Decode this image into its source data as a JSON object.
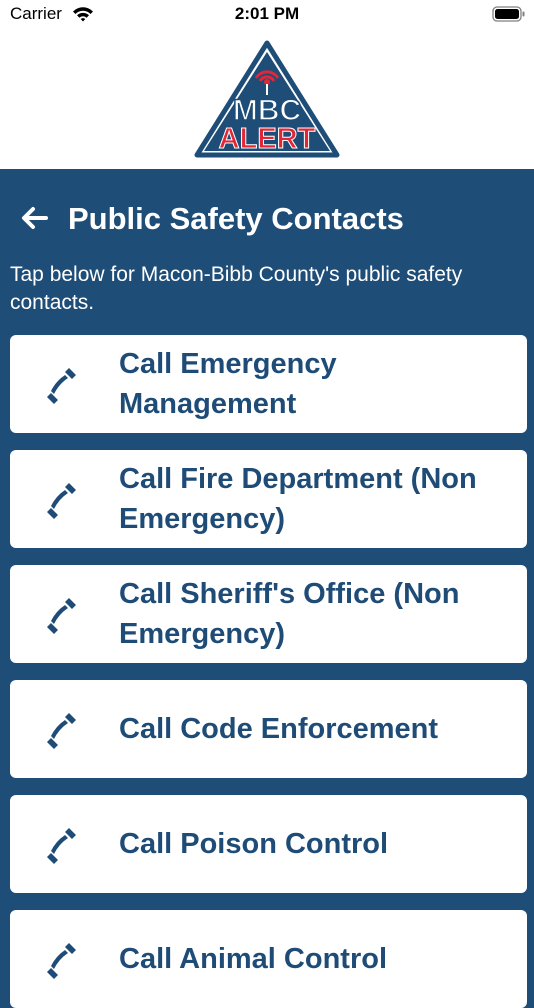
{
  "status_bar": {
    "carrier": "Carrier",
    "time": "2:01 PM"
  },
  "logo": {
    "line1": "MBC",
    "line2": "ALERT"
  },
  "header": {
    "title": "Public Safety Contacts",
    "back_icon": "arrow-left-icon"
  },
  "intro": "Tap below for Macon-Bibb County's public safety contacts.",
  "contacts": [
    {
      "label": "Call Emergency Management",
      "icon": "phone-icon"
    },
    {
      "label": "Call Fire Department (Non Emergency)",
      "icon": "phone-icon"
    },
    {
      "label": "Call Sheriff's Office (Non Emergency)",
      "icon": "phone-icon"
    },
    {
      "label": "Call Code Enforcement",
      "icon": "phone-icon"
    },
    {
      "label": "Call Poison Control",
      "icon": "phone-icon"
    },
    {
      "label": "Call Animal Control",
      "icon": "phone-icon"
    }
  ],
  "colors": {
    "primary": "#1e4d78",
    "text_dark": "#1f4c77",
    "logo_red": "#e32636"
  }
}
